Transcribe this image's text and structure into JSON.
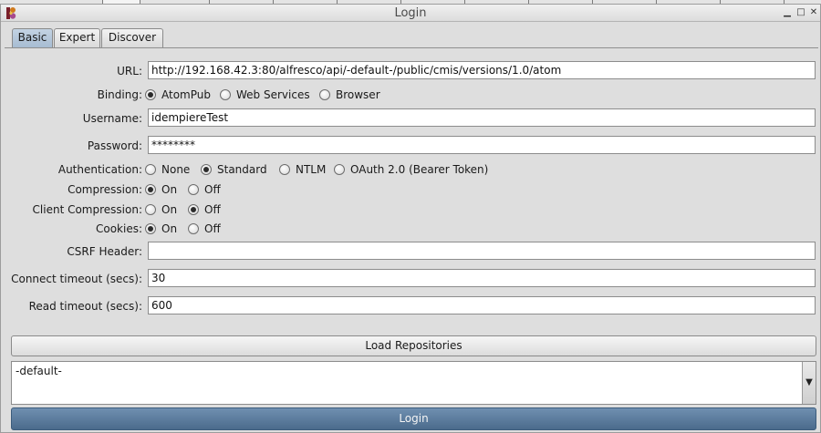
{
  "window": {
    "title": "Login"
  },
  "tabs": [
    {
      "label": "Basic",
      "active": true
    },
    {
      "label": "Expert",
      "active": false
    },
    {
      "label": "Discover",
      "active": false
    }
  ],
  "form": {
    "url": {
      "label": "URL:",
      "value": "http://192.168.42.3:80/alfresco/api/-default-/public/cmis/versions/1.0/atom"
    },
    "binding": {
      "label": "Binding:",
      "options": [
        "AtomPub",
        "Web Services",
        "Browser"
      ],
      "selected": "AtomPub"
    },
    "username": {
      "label": "Username:",
      "value": "idempiereTest"
    },
    "password": {
      "label": "Password:",
      "value": "********"
    },
    "authentication": {
      "label": "Authentication:",
      "options": [
        "None",
        "Standard",
        "NTLM",
        "OAuth 2.0 (Bearer Token)"
      ],
      "selected": "Standard"
    },
    "compression": {
      "label": "Compression:",
      "options": [
        "On",
        "Off"
      ],
      "selected": "On"
    },
    "client_compression": {
      "label": "Client Compression:",
      "options": [
        "On",
        "Off"
      ],
      "selected": "Off"
    },
    "cookies": {
      "label": "Cookies:",
      "options": [
        "On",
        "Off"
      ],
      "selected": "On"
    },
    "csrf_header": {
      "label": "CSRF Header:",
      "value": ""
    },
    "connect_timeout": {
      "label": "Connect timeout (secs):",
      "value": "30"
    },
    "read_timeout": {
      "label": "Read timeout (secs):",
      "value": "600"
    }
  },
  "load_repositories_label": "Load Repositories",
  "repositories": [
    "-default-"
  ],
  "login_label": "Login",
  "icons": {
    "app": "app-logo-icon",
    "minimize": "minimize-icon",
    "maximize": "maximize-icon",
    "close": "close-icon",
    "dropdown": "chevron-down-icon"
  },
  "colors": {
    "active_tab": "#b4c7db",
    "login_button": "#5a7a9b"
  }
}
